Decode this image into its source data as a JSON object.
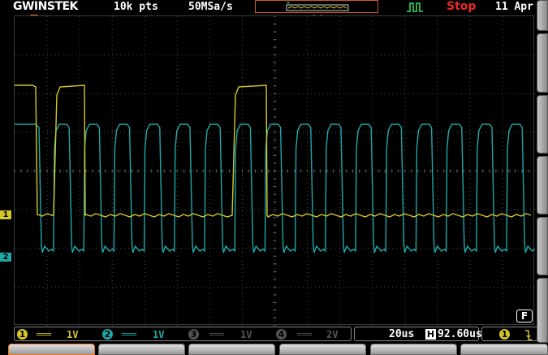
{
  "header": {
    "brand": "GWINSTEK",
    "record_length": "10k pts",
    "sample_rate": "50MSa/s",
    "acq_status": "Stop",
    "date": "11 Apr"
  },
  "channels": [
    {
      "num": "1",
      "coupling": "DC",
      "scale": "1V",
      "color": "#d4c72a",
      "enabled": true
    },
    {
      "num": "2",
      "coupling": "DC",
      "scale": "1V",
      "color": "#1fa8a8",
      "enabled": true
    },
    {
      "num": "3",
      "coupling": "DC",
      "scale": "1V",
      "color": "#555555",
      "enabled": false
    },
    {
      "num": "4",
      "coupling": "DC",
      "scale": "2V",
      "color": "#555555",
      "enabled": false
    }
  ],
  "timebase": {
    "scale": "20us",
    "h_icon": "H",
    "position": "92.60us"
  },
  "trigger": {
    "source": "1",
    "slope": "falling-edge-icon"
  },
  "badge": "F",
  "softkeys": [
    "",
    "",
    "",
    "",
    "",
    ""
  ],
  "colors": {
    "ch1": "#d4c72a",
    "ch2": "#1fa8a8",
    "trigger_marker": "#e8741a",
    "stop": "#e82929",
    "grid": "#4a4a4a"
  }
}
